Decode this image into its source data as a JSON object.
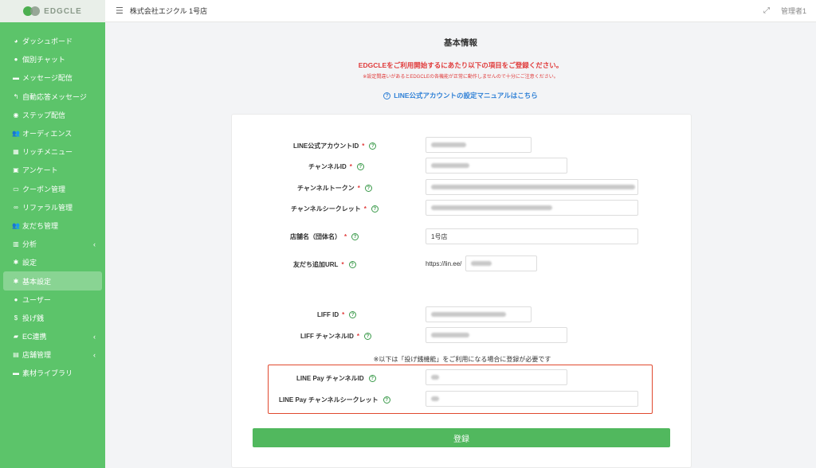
{
  "brand": {
    "name": "EDGCLE"
  },
  "sidebar": {
    "items": [
      {
        "label": "ダッシュボード",
        "icon": "dashboard-icon",
        "glyph": "◕"
      },
      {
        "label": "個別チャット",
        "icon": "chat-icon",
        "glyph": "●"
      },
      {
        "label": "メッセージ配信",
        "icon": "message-icon",
        "glyph": "▬"
      },
      {
        "label": "自動応答メッセージ",
        "icon": "reply-icon",
        "glyph": "↰"
      },
      {
        "label": "ステップ配信",
        "icon": "step-icon",
        "glyph": "◉"
      },
      {
        "label": "オーディエンス",
        "icon": "audience-icon",
        "glyph": "👥"
      },
      {
        "label": "リッチメニュー",
        "icon": "rich-menu-icon",
        "glyph": "▦"
      },
      {
        "label": "アンケート",
        "icon": "survey-icon",
        "glyph": "▣"
      },
      {
        "label": "クーポン管理",
        "icon": "coupon-icon",
        "glyph": "▭"
      },
      {
        "label": "リファラル管理",
        "icon": "link-icon",
        "glyph": "∞"
      },
      {
        "label": "友だち管理",
        "icon": "friends-icon",
        "glyph": "👥"
      },
      {
        "label": "分析",
        "icon": "analytics-icon",
        "glyph": "▥",
        "chevron": "‹"
      },
      {
        "label": "設定",
        "icon": "settings-icon",
        "glyph": "✱"
      },
      {
        "label": "基本設定",
        "icon": "basic-settings-icon",
        "glyph": "✱",
        "active": true
      },
      {
        "label": "ユーザー",
        "icon": "user-icon",
        "glyph": "●"
      },
      {
        "label": "投げ銭",
        "icon": "tip-icon",
        "glyph": "$"
      },
      {
        "label": "EC連携",
        "icon": "ec-icon",
        "glyph": "▰",
        "chevron": "‹"
      },
      {
        "label": "店舗管理",
        "icon": "store-icon",
        "glyph": "▤",
        "chevron": "‹"
      },
      {
        "label": "素材ライブラリ",
        "icon": "folder-icon",
        "glyph": "▬"
      }
    ]
  },
  "topbar": {
    "store_name": "株式会社エジクル 1号店",
    "user": "管理者1"
  },
  "main": {
    "title": "基本情報",
    "notice_main": "EDGCLEをご利用開始するにあたり以下の項目をご登録ください。",
    "notice_sub": "※設定間違いがあるとEDGCLEの各機能が正常に動作しませんので十分にご注意ください。",
    "manual_link": "LINE公式アカウントの設定マニュアルはこちら",
    "optional_note": "※以下は「投げ銭機能」をご利用になる場合に登録が必要です",
    "submit_label": "登録"
  },
  "form": {
    "line_account_id": {
      "label": "LINE公式アカウントID",
      "required": "*"
    },
    "channel_id": {
      "label": "チャンネルID",
      "required": "*"
    },
    "channel_token": {
      "label": "チャンネルトークン",
      "required": "*"
    },
    "channel_secret": {
      "label": "チャンネルシークレット",
      "required": "*"
    },
    "store_name": {
      "label": "店舗名（団体名）",
      "required": "*",
      "value": "1号店"
    },
    "friend_url": {
      "label": "友だち追加URL",
      "required": "*",
      "prefix": "https://lin.ee/"
    },
    "liff_id": {
      "label": "LIFF ID",
      "required": "*"
    },
    "liff_channel_id": {
      "label": "LIFF チャンネルID",
      "required": "*"
    },
    "linepay_channel_id": {
      "label": "LINE Pay チャンネルID"
    },
    "linepay_channel_secret": {
      "label": "LINE Pay チャンネルシークレット"
    }
  },
  "colors": {
    "sidebar": "#5cc46a",
    "accent_red": "#e03b3b",
    "link_blue": "#2f80d6",
    "button_green": "#51b85e"
  }
}
